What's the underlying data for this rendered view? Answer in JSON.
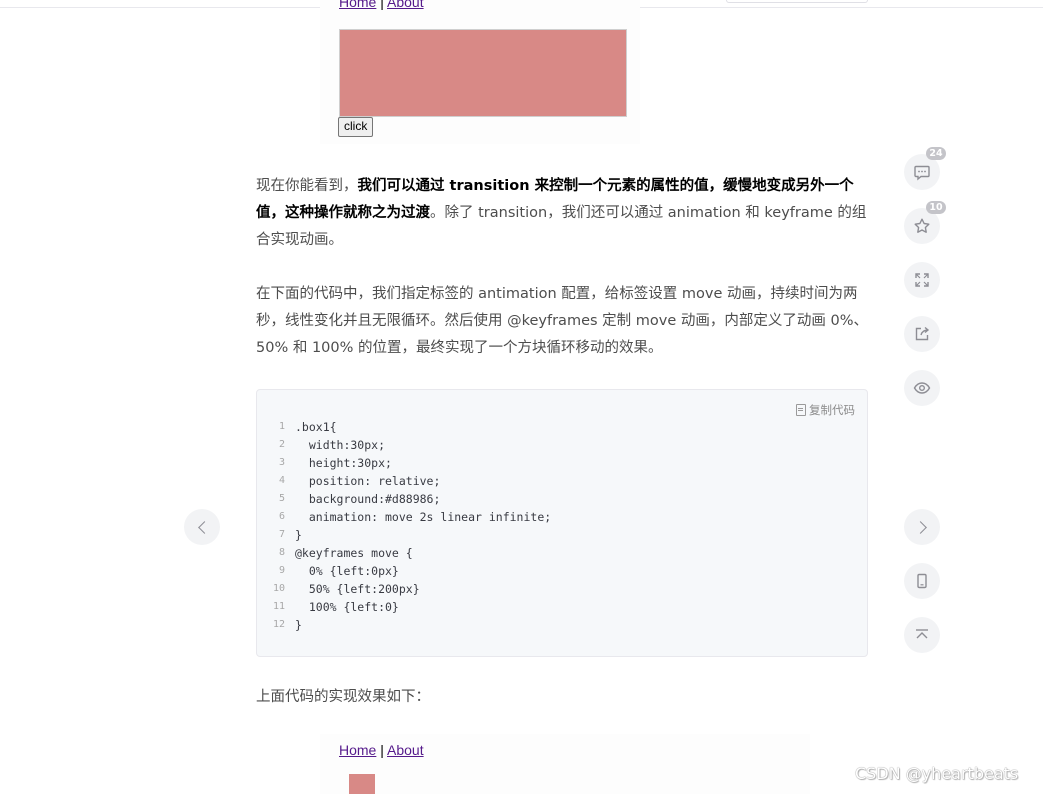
{
  "demo_top": {
    "nav_home": "Home",
    "nav_separator": "|",
    "nav_about": "About",
    "button_label": "click"
  },
  "article": {
    "p1_lead": "现在你能看到，",
    "p1_bold": "我们可以通过 transition 来控制一个元素的属性的值，缓慢地变成另外一个值，这种操作就称之为过渡",
    "p1_tail": "。除了 transition，我们还可以通过 animation 和 keyframe 的组合实现动画。",
    "p2": "在下面的代码中，我们指定标签的 antimation 配置，给标签设置 move 动画，持续时间为两秒，线性变化并且无限循环。然后使用 @keyframes 定制 move 动画，内部定义了动画 0%、50% 和 100% 的位置，最终实现了一个方块循环移动的效果。",
    "p3": "上面代码的实现效果如下："
  },
  "code_block": {
    "copy_label": "复制代码",
    "lines": [
      {
        "num": "1",
        "text": ".box1{"
      },
      {
        "num": "2",
        "text": "  width:30px;"
      },
      {
        "num": "3",
        "text": "  height:30px;"
      },
      {
        "num": "4",
        "text": "  position: relative;"
      },
      {
        "num": "5",
        "text": "  background:#d88986;"
      },
      {
        "num": "6",
        "text": "  animation: move 2s linear infinite;"
      },
      {
        "num": "7",
        "text": "}"
      },
      {
        "num": "8",
        "text": "@keyframes move {"
      },
      {
        "num": "9",
        "text": "  0% {left:0px}"
      },
      {
        "num": "10",
        "text": "  50% {left:200px}"
      },
      {
        "num": "11",
        "text": "  100% {left:0}"
      },
      {
        "num": "12",
        "text": "}"
      }
    ]
  },
  "demo_bottom": {
    "nav_home": "Home",
    "nav_separator": "|",
    "nav_about": "About"
  },
  "toolbar": {
    "comment_count": "24",
    "favorite_count": "10",
    "icons": [
      "comment-icon",
      "star-icon",
      "expand-icon",
      "share-icon",
      "eye-icon",
      "mobile-icon",
      "back-to-top-icon"
    ]
  },
  "watermark": "CSDN @yheartbeats",
  "colors": {
    "demo_box": "#d88986",
    "code_bg": "#f6f8fa",
    "link": "#551a8b",
    "icon_bg": "#f2f3f5"
  }
}
